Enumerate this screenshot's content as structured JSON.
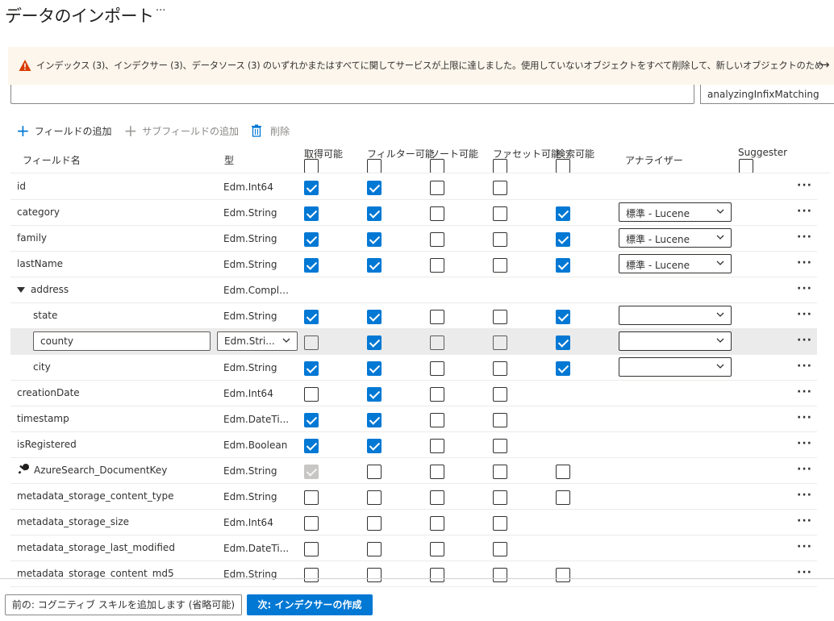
{
  "page": {
    "title": "データのインポート",
    "more_label": "···"
  },
  "warning": {
    "text": "インデックス (3)、インデクサー (3)、データソース (3) のいずれかまたはすべてに関してサービスが上限に達しました。使用していないオブジェクトをすべて削除して、新しいオブジェクトのための空き容量を作ってください。",
    "arrow": "→"
  },
  "top_inputs": {
    "left_value": "",
    "right_value": "analyzingInfixMatching"
  },
  "toolbar": {
    "add_field": "フィールドの追加",
    "add_subfield": "サブフィールドの追加",
    "delete": "削除"
  },
  "columns": {
    "field_name": "フィールド名",
    "type": "型",
    "retrievable": "取得可能",
    "filterable": "フィルター可能",
    "sortable": "ソート可能",
    "facetable": "ファセット可能",
    "searchable": "検索可能",
    "analyzer": "アナライザー",
    "suggester": "Suggester"
  },
  "rows": [
    {
      "name": "id",
      "type": "Edm.Int64",
      "retrievable": "on",
      "filterable": "on",
      "sortable": "off",
      "facetable": "off",
      "searchable": "none",
      "analyzer": null
    },
    {
      "name": "category",
      "type": "Edm.String",
      "retrievable": "on",
      "filterable": "on",
      "sortable": "off",
      "facetable": "off",
      "searchable": "on",
      "analyzer": "標準 - Lucene"
    },
    {
      "name": "family",
      "type": "Edm.String",
      "retrievable": "on",
      "filterable": "on",
      "sortable": "off",
      "facetable": "off",
      "searchable": "on",
      "analyzer": "標準 - Lucene"
    },
    {
      "name": "lastName",
      "type": "Edm.String",
      "retrievable": "on",
      "filterable": "on",
      "sortable": "off",
      "facetable": "off",
      "searchable": "on",
      "analyzer": "標準 - Lucene"
    },
    {
      "name": "address",
      "type": "Edm.Comple...",
      "complex": true
    },
    {
      "name": "state",
      "type": "Edm.String",
      "indent": true,
      "retrievable": "on",
      "filterable": "on",
      "sortable": "off",
      "facetable": "off",
      "searchable": "on",
      "analyzer": ""
    },
    {
      "name": "county",
      "type": "Edm.Stri...",
      "editing": true,
      "retrievable": "off",
      "filterable": "on",
      "sortable": "off",
      "facetable": "off",
      "searchable": "on",
      "analyzer": ""
    },
    {
      "name": "city",
      "type": "Edm.String",
      "indent": true,
      "retrievable": "on",
      "filterable": "on",
      "sortable": "off",
      "facetable": "off",
      "searchable": "on",
      "analyzer": ""
    },
    {
      "name": "creationDate",
      "type": "Edm.Int64",
      "retrievable": "off",
      "filterable": "on",
      "sortable": "off",
      "facetable": "off",
      "searchable": "none",
      "analyzer": null
    },
    {
      "name": "timestamp",
      "type": "Edm.DateTi...",
      "retrievable": "on",
      "filterable": "on",
      "sortable": "off",
      "facetable": "off",
      "searchable": "none",
      "analyzer": null
    },
    {
      "name": "isRegistered",
      "type": "Edm.Boolean",
      "retrievable": "on",
      "filterable": "on",
      "sortable": "off",
      "facetable": "off",
      "searchable": "none",
      "analyzer": null
    },
    {
      "name": "AzureSearch_DocumentKey",
      "type": "Edm.String",
      "key": true,
      "retrievable": "disabled",
      "filterable": "off",
      "sortable": "off",
      "facetable": "off",
      "searchable": "off",
      "analyzer": null
    },
    {
      "name": "metadata_storage_content_type",
      "type": "Edm.String",
      "retrievable": "off",
      "filterable": "off",
      "sortable": "off",
      "facetable": "off",
      "searchable": "off",
      "analyzer": null
    },
    {
      "name": "metadata_storage_size",
      "type": "Edm.Int64",
      "retrievable": "off",
      "filterable": "off",
      "sortable": "off",
      "facetable": "off",
      "searchable": "none",
      "analyzer": null
    },
    {
      "name": "metadata_storage_last_modified",
      "type": "Edm.DateTi...",
      "retrievable": "off",
      "filterable": "off",
      "sortable": "off",
      "facetable": "off",
      "searchable": "none",
      "analyzer": null
    },
    {
      "name": "metadata_storage_content_md5",
      "type": "Edm.String",
      "retrievable": "off",
      "filterable": "off",
      "sortable": "off",
      "facetable": "off",
      "searchable": "off",
      "analyzer": null
    }
  ],
  "row_more_label": "···",
  "footer": {
    "prev_label": "前の: コグニティブ スキルを追加します (省略可能)",
    "next_label": "次: インデクサーの作成"
  },
  "colors": {
    "accent": "#0078d4",
    "warning_bg": "#fdf6ec",
    "warning_icon": "#d83b01"
  }
}
